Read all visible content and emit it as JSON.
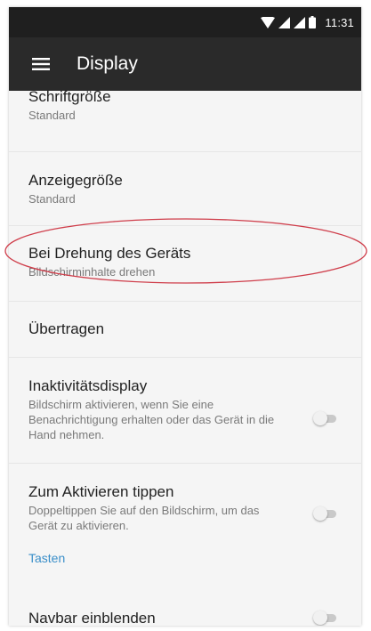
{
  "status_bar": {
    "time": "11:31",
    "icons": [
      "wifi-icon",
      "signal-icon",
      "signal-icon",
      "battery-icon"
    ]
  },
  "app_bar": {
    "menu_icon": "menu-icon",
    "title": "Display"
  },
  "settings": [
    {
      "title": "Schriftgröße",
      "subtitle": "Standard"
    },
    {
      "title": "Anzeigegröße",
      "subtitle": "Standard"
    },
    {
      "title": "Bei Drehung des Geräts",
      "subtitle": "Bildschirminhalte drehen",
      "highlighted": true
    },
    {
      "title": "Übertragen"
    },
    {
      "title": "Inaktivitätsdisplay",
      "subtitle": "Bildschirm aktivieren, wenn Sie eine Benachrichtigung erhalten oder das Gerät in die Hand nehmen.",
      "toggle": false
    },
    {
      "title": "Zum Aktivieren tippen",
      "subtitle": "Doppeltippen Sie auf den Bildschirm, um das Gerät zu aktivieren.",
      "toggle": false
    }
  ],
  "section": {
    "header": "Tasten",
    "items": [
      {
        "title": "Navbar einblenden",
        "toggle": false
      }
    ]
  },
  "colors": {
    "status_bar_bg": "#1f1f1f",
    "app_bar_bg": "#2a2a2a",
    "section_accent": "#3b8fc9",
    "highlight_ellipse": "#cf3d4a"
  }
}
